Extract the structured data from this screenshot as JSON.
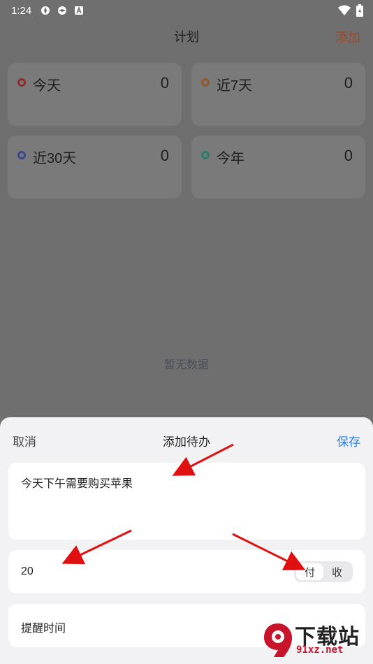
{
  "status_bar": {
    "time": "1:24"
  },
  "header": {
    "title": "计划",
    "add_label": "添加"
  },
  "cards": [
    {
      "label": "今天",
      "count": "0",
      "color": "#8d2f2f"
    },
    {
      "label": "近7天",
      "count": "0",
      "color": "#8f5a2c"
    },
    {
      "label": "近30天",
      "count": "0",
      "color": "#3a4790"
    },
    {
      "label": "今年",
      "count": "0",
      "color": "#2f7a6d"
    }
  ],
  "empty_text": "暂无数据",
  "sheet": {
    "cancel_label": "取消",
    "title": "添加待办",
    "save_label": "保存",
    "note_text": "今天下午需要购买苹果",
    "amount_value": "20",
    "toggle_options": [
      "付",
      "收"
    ],
    "toggle_selected": "付",
    "remind_label": "提醒时间"
  },
  "watermark": {
    "title": "下载站",
    "url": "91xz.net"
  }
}
